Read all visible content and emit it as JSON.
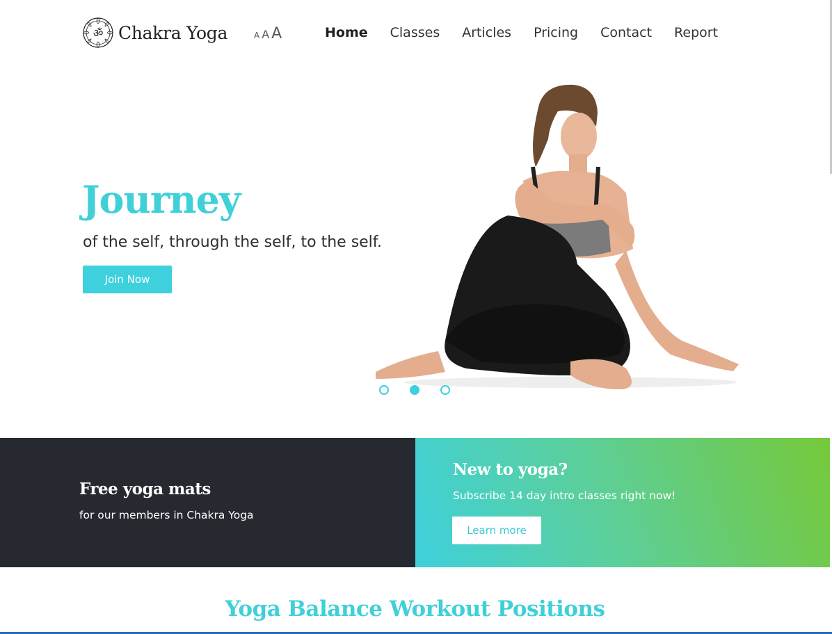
{
  "brand": {
    "name": "Chakra Yoga",
    "logo_icon": "om-icon"
  },
  "font_size_control": {
    "small": "A",
    "medium": "A",
    "large": "A"
  },
  "nav": {
    "items": [
      {
        "label": "Home",
        "active": true
      },
      {
        "label": "Classes"
      },
      {
        "label": "Articles"
      },
      {
        "label": "Pricing"
      },
      {
        "label": "Contact"
      },
      {
        "label": "Report"
      }
    ]
  },
  "hero": {
    "title": "Journey",
    "subtitle": "of the self, through the self, to the self.",
    "cta_label": "Join Now",
    "slides_total": 3,
    "active_slide": 2
  },
  "promo": {
    "left": {
      "title": "Free yoga mats",
      "text": "for our members in Chakra Yoga"
    },
    "right": {
      "title": "New to yoga?",
      "text": "Subscribe 14 day intro classes right now!",
      "cta_label": "Learn more"
    }
  },
  "section": {
    "title": "Yoga Balance Workout Positions"
  },
  "colors": {
    "accent": "#3fd0dd",
    "dark": "#262a30",
    "gradient_end": "#76c93a"
  }
}
